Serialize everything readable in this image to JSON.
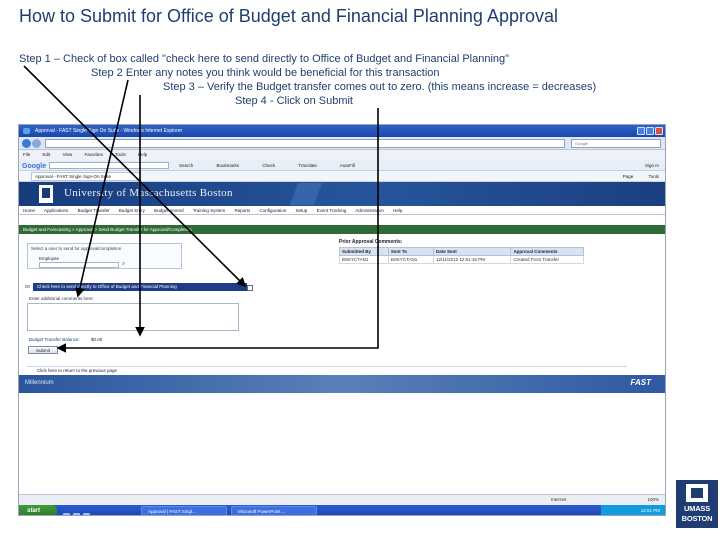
{
  "slide": {
    "title": "How to Submit for Office of Budget and Financial Planning Approval",
    "steps": [
      "Step 1 – Check of box called \"check here to send directly to Office of Budget and Financial Planning\"",
      "Step 2 Enter any notes you think would be beneficial for this transaction",
      "Step 3 – Verify the Budget transfer comes out to zero. (this means increase = decreases)",
      "Step 4 - Click on Submit"
    ]
  },
  "browser": {
    "title_bar": "Approval - FAST Single Sign On Suite - Windows Internet Explorer",
    "search_engine": "Google",
    "menu": [
      "File",
      "Edit",
      "View",
      "Favorites",
      "Tools",
      "Help"
    ],
    "toolbar": [
      "Search",
      "Bookmarks",
      "Check",
      "Translate",
      "AutoFill"
    ],
    "signin": "Sign In",
    "tab_label": "Approval - FAST Single Sign-On Suite",
    "tools": [
      "Page",
      "Tools"
    ]
  },
  "app": {
    "university": "University of Massachusetts Boston",
    "nav": [
      "Home",
      "Applications",
      "Budget Transfer",
      "Budget Entry",
      "Budget Amend",
      "Training System",
      "Reports",
      "Configuration",
      "Setup",
      "Event Tracking",
      "Administration",
      "Help"
    ],
    "breadcrumb": "Budget and Forecasting > Approval > Send Budget Transfer for Approval/Completion",
    "select_prompt": "Select a user to send for approval/completion",
    "employee_label": "Employee",
    "prior_comments": {
      "heading": "Prior Approval Comments:",
      "columns": [
        "Submitted By",
        "Sent To",
        "Date Sent",
        "Approval Comments"
      ],
      "rows": [
        [
          "BSKYCTAN1",
          "BSKYCTAN1",
          "12/11/2012 12:51:16 PM",
          "Created From Transfer"
        ]
      ]
    },
    "checkbox_label": "Check here to send directly to Office of Budget and Financial Planning",
    "checkbox_prefix": "Or",
    "checkbox_checked": false,
    "notes_label": "Enter additional comments here:",
    "notes_value": "",
    "balance_label": "Budget Transfer Balance:",
    "balance_value": "$0.00",
    "submit_label": "Submit",
    "return_link": "Click here to return to the previous page",
    "footer_left": "Millennium",
    "footer_right": "FAST"
  },
  "status": {
    "zone": "Internet",
    "zoom": "100%"
  },
  "taskbar": {
    "start": "start",
    "tasks": [
      "Approval | FAST Singl...",
      "Microsoft PowerPoint ..."
    ],
    "clock": "12:51 PM"
  },
  "brand": {
    "line1": "UMASS",
    "line2": "BOSTON"
  },
  "colors": {
    "title_text": "#1f3f6e",
    "banner": "#173c7c",
    "breadcrumb_bar": "#2f6a37",
    "checkbox_row": "#1f3d86",
    "brand": "#1f3c73"
  }
}
